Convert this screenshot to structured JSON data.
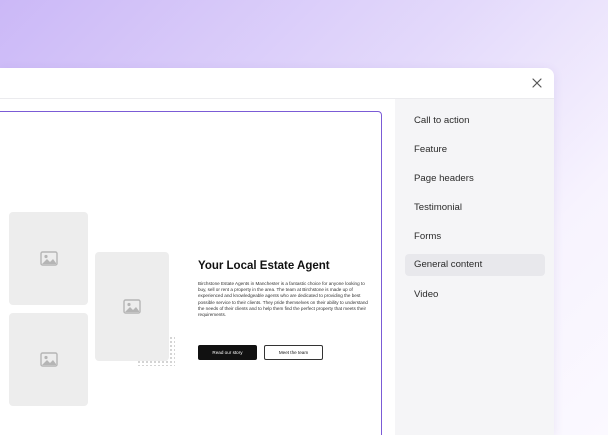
{
  "preview": {
    "heading": "Your Local Estate Agent",
    "body": "Birchstone Estate Agents in Manchester is a fantastic choice for anyone looking to buy, sell or rent a property in the area. The team at Birchstone is made up of experienced and knowledgeable agents who are dedicated to providing the best possible service to their clients. They pride themselves on their ability to understand the needs of their clients and to help them find the perfect property that meets their requirements.",
    "primary_button": "Read our story",
    "secondary_button": "Meet the team"
  },
  "sidebar": {
    "items": [
      {
        "label": "Call to action"
      },
      {
        "label": "Feature"
      },
      {
        "label": "Page headers"
      },
      {
        "label": "Testimonial"
      },
      {
        "label": "Forms"
      },
      {
        "label": "General content",
        "active": true
      },
      {
        "label": "Video"
      }
    ]
  },
  "colors": {
    "accent": "#7b5bd6",
    "placeholder": "#ededed",
    "primary_button": "#111111"
  },
  "icons": {
    "close": "close-icon",
    "placeholder": "image-placeholder-icon"
  }
}
